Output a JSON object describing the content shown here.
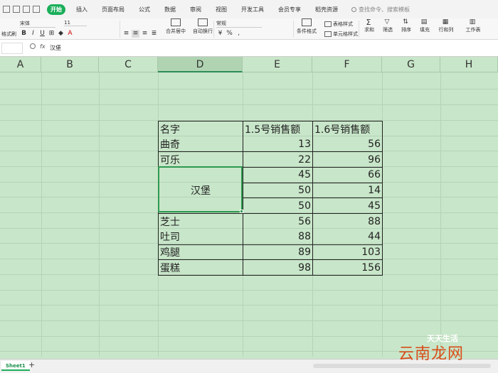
{
  "menu": {
    "tabs": [
      "开始",
      "插入",
      "页面布局",
      "公式",
      "数据",
      "审阅",
      "视图",
      "开发工具",
      "会员专享",
      "稻壳资源"
    ],
    "active_tab": "开始",
    "search_placeholder": "查找命令、搜索模板"
  },
  "ribbon": {
    "paste_label": "格式刷",
    "font_name": "宋体",
    "font_size": "11",
    "merge_label": "合并居中",
    "wrap_label": "自动换行",
    "number_format": "常规",
    "cond_format_label": "条件格式",
    "table_style_label": "表格样式",
    "cell_style_label": "单元格样式",
    "sum_label": "求和",
    "filter_label": "筛选",
    "sort_label": "排序",
    "fill_label": "填充",
    "rowcol_label": "行和列",
    "sheet_label": "工作表"
  },
  "formula_bar": {
    "fx": "fx",
    "content": "汉堡"
  },
  "columns": [
    "A",
    "B",
    "C",
    "D",
    "E",
    "F",
    "G",
    "H"
  ],
  "selected_column": "D",
  "table": {
    "header": [
      "名字",
      "1.5号销售额",
      "1.6号销售额"
    ],
    "rows": [
      {
        "name": "曲奇",
        "v1": "13",
        "v2": "56"
      },
      {
        "name": "可乐",
        "v1": "22",
        "v2": "96"
      },
      {
        "name": "汉堡",
        "v1": "45",
        "v2": "66"
      },
      {
        "name": "",
        "v1": "50",
        "v2": "14"
      },
      {
        "name": "",
        "v1": "50",
        "v2": "45"
      },
      {
        "name": "芝士",
        "v1": "56",
        "v2": "88"
      },
      {
        "name": "吐司",
        "v1": "88",
        "v2": "44"
      },
      {
        "name": "鸡腿",
        "v1": "89",
        "v2": "103"
      },
      {
        "name": "蛋糕",
        "v1": "98",
        "v2": "156"
      }
    ]
  },
  "sheet": {
    "tab_name": "Sheet1",
    "add_symbol": "+"
  },
  "watermark": "云南龙网",
  "watermark_small": "天天生活"
}
